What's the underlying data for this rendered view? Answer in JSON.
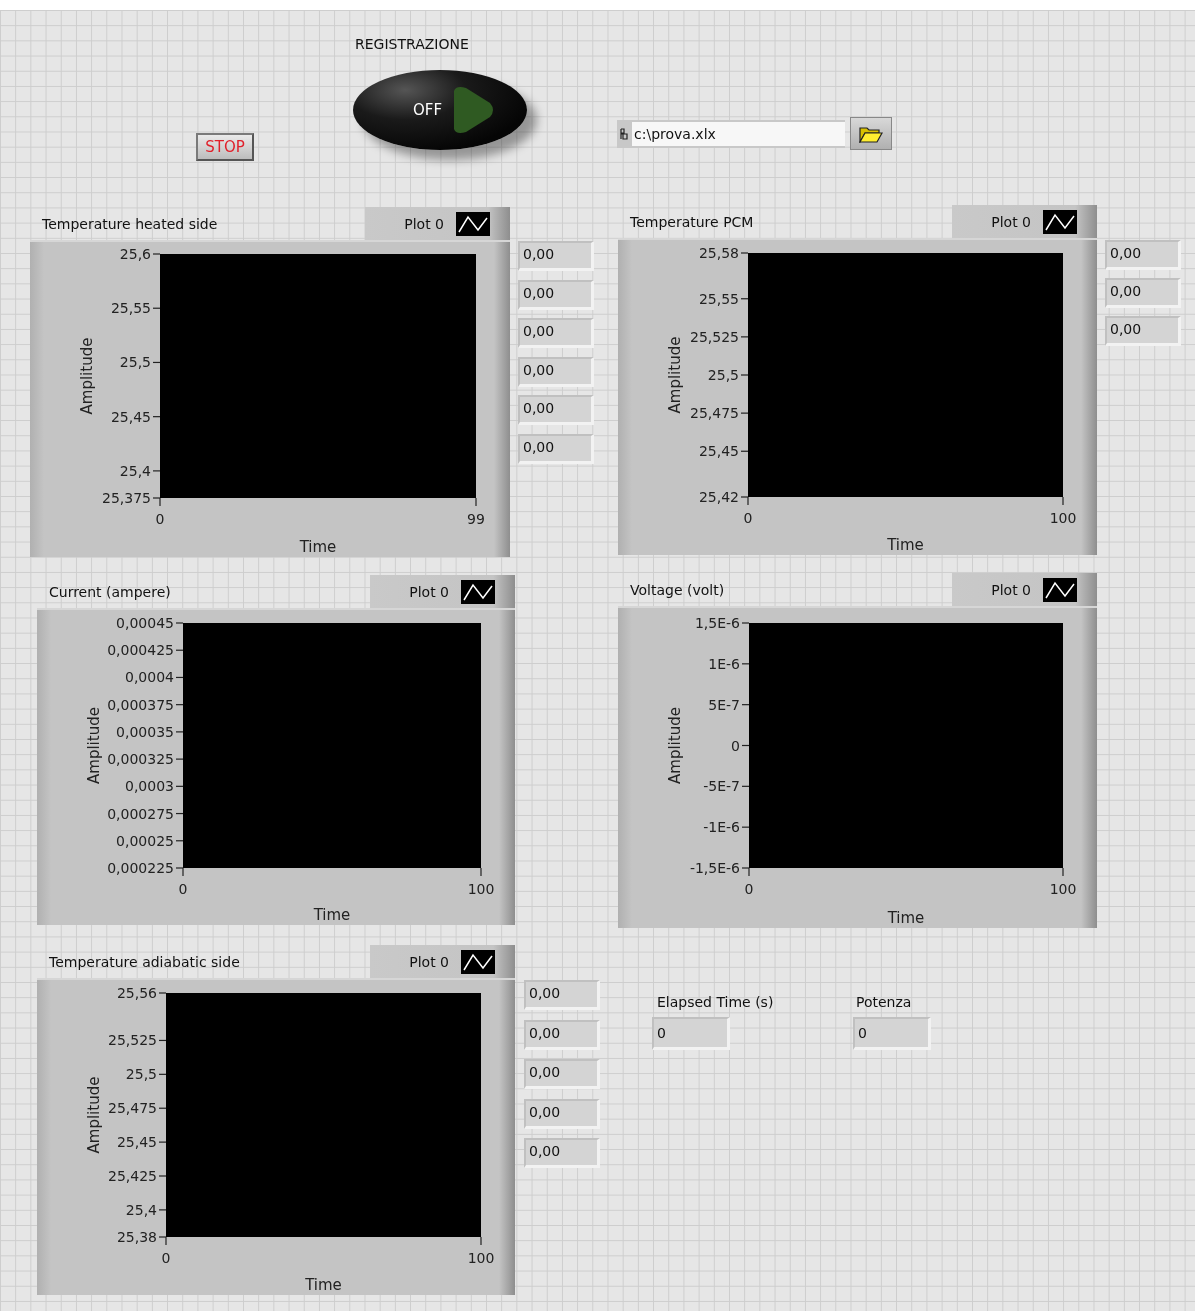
{
  "record_switch": {
    "label": "REGISTRAZIONE",
    "text": "OFF",
    "on": false
  },
  "stop_button": {
    "label": "STOP"
  },
  "file_path": {
    "value": "c:\\prova.xlx"
  },
  "graphs": [
    {
      "title": "Temperature heated side",
      "legend": "Plot 0",
      "indicators": [
        "0,00",
        "0,00",
        "0,00",
        "0,00",
        "0,00",
        "0,00"
      ],
      "xlabel": "Time",
      "ylabel": "Amplitude",
      "x_tick_labels": [
        "0",
        "99"
      ],
      "y_tick_labels": [
        "25,6",
        "25,55",
        "25,5",
        "25,45",
        "25,4",
        "25,375"
      ]
    },
    {
      "title": "Temperature PCM",
      "legend": "Plot 0",
      "indicators": [
        "0,00",
        "0,00",
        "0,00"
      ],
      "xlabel": "Time",
      "ylabel": "Amplitude",
      "x_tick_labels": [
        "0",
        "100"
      ],
      "y_tick_labels": [
        "25,58",
        "25,55",
        "25,525",
        "25,5",
        "25,475",
        "25,45",
        "25,42"
      ]
    },
    {
      "title": "Current (ampere)",
      "legend": "Plot 0",
      "xlabel": "Time",
      "ylabel": "Amplitude",
      "x_tick_labels": [
        "0",
        "100"
      ],
      "y_tick_labels": [
        "0,00045",
        "0,000425",
        "0,0004",
        "0,000375",
        "0,00035",
        "0,000325",
        "0,0003",
        "0,000275",
        "0,00025",
        "0,000225"
      ]
    },
    {
      "title": "Voltage (volt)",
      "legend": "Plot 0",
      "xlabel": "Time",
      "ylabel": "Amplitude",
      "x_tick_labels": [
        "0",
        "100"
      ],
      "y_tick_labels": [
        "1,5E-6",
        "1E-6",
        "5E-7",
        "0",
        "-5E-7",
        "-1E-6",
        "-1,5E-6"
      ]
    },
    {
      "title": "Temperature adiabatic side",
      "legend": "Plot 0",
      "indicators": [
        "0,00",
        "0,00",
        "0,00",
        "0,00",
        "0,00"
      ],
      "xlabel": "Time",
      "ylabel": "Amplitude",
      "x_tick_labels": [
        "0",
        "100"
      ],
      "y_tick_labels": [
        "25,56",
        "25,525",
        "25,5",
        "25,475",
        "25,45",
        "25,425",
        "25,4",
        "25,38"
      ]
    }
  ],
  "elapsed_time": {
    "label": "Elapsed Time (s)",
    "value": "0"
  },
  "power": {
    "label": "Potenza",
    "value": "0"
  }
}
